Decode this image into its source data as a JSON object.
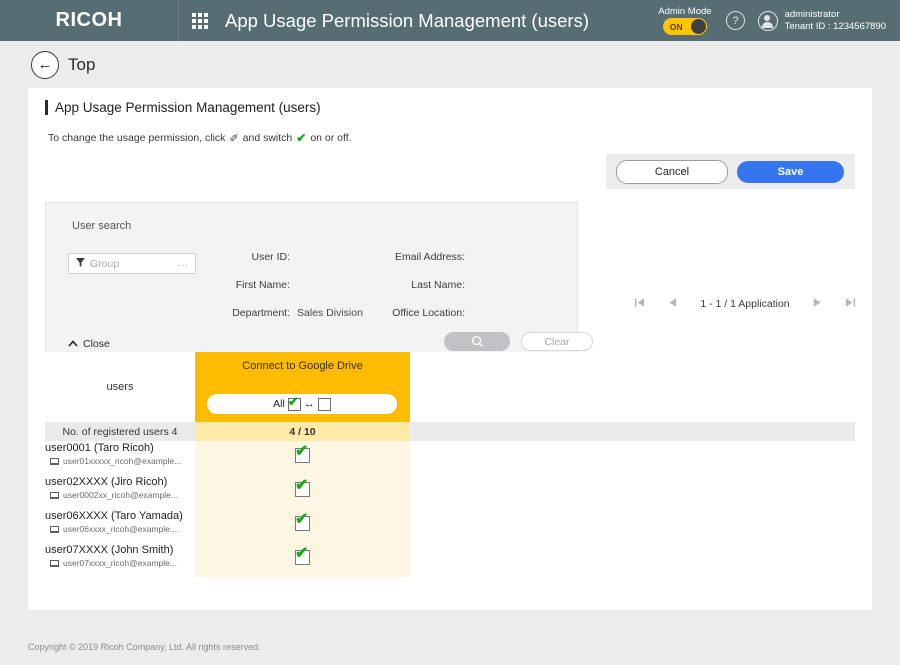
{
  "header": {
    "brand": "RICOH",
    "app_title": "App Usage Permission Management (users)",
    "admin_mode_label": "Admin Mode",
    "admin_mode_state": "ON",
    "help_glyph": "?",
    "account_name": "administrator",
    "tenant": "Tenant ID : 1234567890"
  },
  "breadcrumb": {
    "back_glyph": "←",
    "label": "Top"
  },
  "page": {
    "title": "App Usage Permission Management (users)",
    "instruction_prefix": "To change the usage permission, click",
    "instruction_middle": "and switch",
    "instruction_suffix": "on or off.",
    "pencil_glyph": "✐",
    "check_glyph": "✔"
  },
  "actions": {
    "cancel_label": "Cancel",
    "save_label": "Save"
  },
  "search": {
    "panel_title": "User search",
    "group_placeholder": "Group",
    "group_value": "",
    "group_dots": "...",
    "funnel_glyph": "▼",
    "fields": [
      {
        "label": "User ID:",
        "value": ""
      },
      {
        "label": "Email Address:",
        "value": ""
      },
      {
        "label": "First Name:",
        "value": ""
      },
      {
        "label": "Last Name:",
        "value": ""
      },
      {
        "label": "Department:",
        "value": "Sales Division"
      },
      {
        "label": "Office Location:",
        "value": ""
      }
    ],
    "search_glyph": "⌕",
    "clear_label": "Clear",
    "close_label": "Close",
    "close_glyph": "▲"
  },
  "pager": {
    "first_glyph": "▏◀",
    "prev_glyph": "◀",
    "text": "1 - 1 / 1 Application",
    "next_glyph": "▶",
    "last_glyph": "▶▕"
  },
  "table": {
    "users_header": "users",
    "app_header": "Connect to Google Drive",
    "all_label": "All",
    "swap_glyph": "↔",
    "count_label": "No. of registered users 4",
    "count_value": "4 / 10",
    "rows": [
      {
        "name": "user0001 (Taro Ricoh)",
        "email": "user01xxxxx_ricoh@example...",
        "permission": true
      },
      {
        "name": "user02XXXX (Jiro Ricoh)",
        "email": "user0002xx_ricoh@example...",
        "permission": true
      },
      {
        "name": "user06XXXX (Taro Yamada)",
        "email": "user06xxxx_ricoh@example....",
        "permission": true
      },
      {
        "name": "user07XXXX (John Smith)",
        "email": "user07xxxx_ricoh@example...",
        "permission": true
      }
    ]
  },
  "footer": {
    "copyright": "Copyright © 2019 Ricoh Company, Ltd. All rights reserved."
  },
  "colors": {
    "header_bar": "#566e73",
    "accent_orange": "#fdbb01",
    "save_blue": "#3576ef",
    "check_green": "#19a319",
    "row_tint": "#fdf6e3"
  }
}
